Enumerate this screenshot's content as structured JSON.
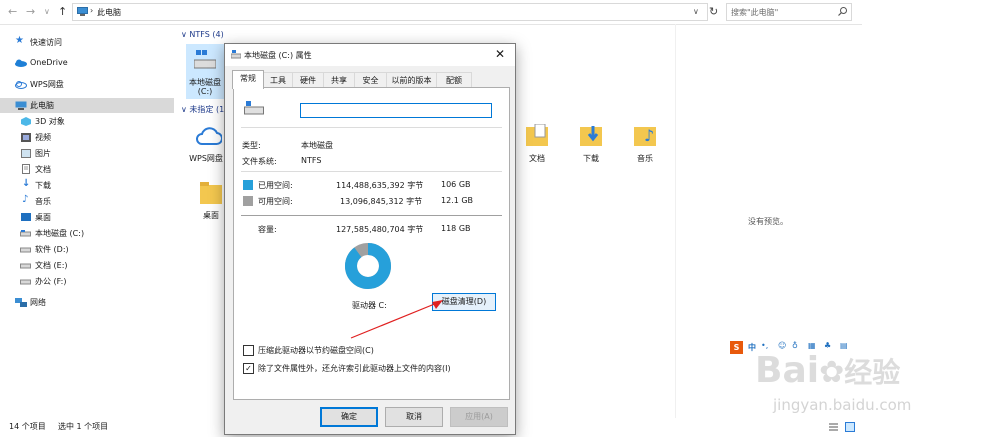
{
  "address": {
    "path_label": "此电脑",
    "search_placeholder": "搜索\"此电脑\""
  },
  "sidebar": {
    "items": [
      {
        "label": "快速访问",
        "icon": "star-icon"
      },
      {
        "label": "OneDrive",
        "icon": "cloud-icon"
      },
      {
        "label": "WPS网盘",
        "icon": "cloud-outline-icon"
      },
      {
        "label": "此电脑",
        "icon": "computer-icon"
      },
      {
        "label": "3D 对象",
        "icon": "cube-icon"
      },
      {
        "label": "视频",
        "icon": "video-icon"
      },
      {
        "label": "图片",
        "icon": "picture-icon"
      },
      {
        "label": "文档",
        "icon": "document-icon"
      },
      {
        "label": "下载",
        "icon": "download-icon"
      },
      {
        "label": "音乐",
        "icon": "music-icon"
      },
      {
        "label": "桌面",
        "icon": "desktop-icon"
      },
      {
        "label": "本地磁盘 (C:)",
        "icon": "drive-icon"
      },
      {
        "label": "软件 (D:)",
        "icon": "drive-icon"
      },
      {
        "label": "文档 (E:)",
        "icon": "drive-icon"
      },
      {
        "label": "办公 (F:)",
        "icon": "drive-icon"
      },
      {
        "label": "网络",
        "icon": "network-icon"
      }
    ]
  },
  "main": {
    "group_ntfs": "NTFS (4)",
    "group_unspecified": "未指定 (1",
    "drive_c_label": "本地磁盘",
    "drive_c_label2": "(C:)",
    "wps_label": "WPS网盘",
    "desktop_label": "桌面",
    "documents_label": "文档",
    "downloads_label": "下载",
    "music_label": "音乐"
  },
  "preview": {
    "no_preview": "没有预览。"
  },
  "status": {
    "item_count": "14 个项目",
    "selected": "选中 1 个项目"
  },
  "dialog": {
    "title": "本地磁盘 (C:) 属性",
    "tabs": [
      "常规",
      "工具",
      "硬件",
      "共享",
      "安全",
      "以前的版本",
      "配额"
    ],
    "name_value": "",
    "type_label": "类型:",
    "type_value": "本地磁盘",
    "fs_label": "文件系统:",
    "fs_value": "NTFS",
    "used_label": "已用空间:",
    "used_bytes": "114,488,635,392 字节",
    "used_gb": "106 GB",
    "free_label": "可用空间:",
    "free_bytes": "13,096,845,312 字节",
    "free_gb": "12.1 GB",
    "capacity_label": "容量:",
    "capacity_bytes": "127,585,480,704 字节",
    "capacity_gb": "118 GB",
    "drive_label": "驱动器 C:",
    "cleanup_button": "磁盘清理(D)",
    "compress_label": "压缩此驱动器以节约磁盘空间(C)",
    "index_label": "除了文件属性外，还允许索引此驱动器上文件的内容(I)",
    "ok": "确定",
    "cancel": "取消",
    "apply": "应用(A)",
    "used_fraction": 0.897,
    "colors": {
      "used": "#26a0da",
      "free": "#a0a0a0"
    }
  },
  "ime": {
    "label": "中"
  },
  "watermark": {
    "brand": "Bai",
    "brand_cn": "经验",
    "url": "jingyan.baidu.com"
  }
}
